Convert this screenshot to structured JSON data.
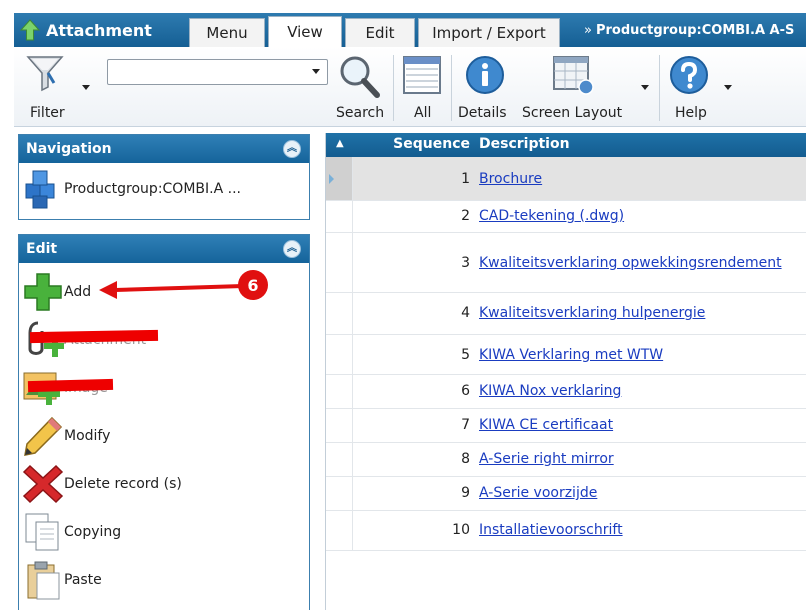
{
  "app": {
    "title": "Attachment",
    "breadcrumb_prefix": "»",
    "breadcrumb": "Productgroup:COMBI.A A-S"
  },
  "tabs": [
    {
      "label": "Menu",
      "active": false
    },
    {
      "label": "View",
      "active": true
    },
    {
      "label": "Edit",
      "active": false
    },
    {
      "label": "Import / Export",
      "active": false
    }
  ],
  "toolbar": {
    "filter_label": "Filter",
    "search_value": "",
    "search_label": "Search",
    "all_label": "All",
    "details_label": "Details",
    "screen_layout_label": "Screen Layout",
    "help_label": "Help"
  },
  "navigation": {
    "header": "Navigation",
    "item_label": "Productgroup:COMBI.A ..."
  },
  "edit_panel": {
    "header": "Edit",
    "items": [
      {
        "label": "Add",
        "icon": "add-plus-icon"
      },
      {
        "label": "Attachment",
        "icon": "attach-add-icon",
        "redacted": true
      },
      {
        "label": "Image",
        "icon": "image-add-icon",
        "redacted": true
      },
      {
        "label": "Modify",
        "icon": "pencil-icon"
      },
      {
        "label": "Delete record (s)",
        "icon": "delete-icon"
      },
      {
        "label": "Copying",
        "icon": "copy-icon"
      },
      {
        "label": "Paste",
        "icon": "paste-icon"
      }
    ]
  },
  "annotation": {
    "number": "6"
  },
  "grid": {
    "columns": {
      "sequence": "Sequence",
      "description": "Description"
    },
    "rows": [
      {
        "seq": "1",
        "description": "Brochure",
        "selected": true
      },
      {
        "seq": "2",
        "description": "CAD-tekening (.dwg)"
      },
      {
        "seq": "3",
        "description": "Kwaliteitsverklaring opwekkingsrendement"
      },
      {
        "seq": "4",
        "description": "Kwaliteitsverklaring hulpenergie"
      },
      {
        "seq": "5",
        "description": "KIWA Verklaring met WTW"
      },
      {
        "seq": "6",
        "description": "KIWA Nox verklaring"
      },
      {
        "seq": "7",
        "description": "KIWA CE certificaat"
      },
      {
        "seq": "8",
        "description": "A-Serie right mirror"
      },
      {
        "seq": "9",
        "description": "A-Serie voorzijde"
      },
      {
        "seq": "10",
        "description": "Installatievoorschrift"
      }
    ]
  },
  "colors": {
    "header_blue": "#1f72a8",
    "link_blue": "#1a3cc0",
    "annotation_red": "#e01010"
  }
}
